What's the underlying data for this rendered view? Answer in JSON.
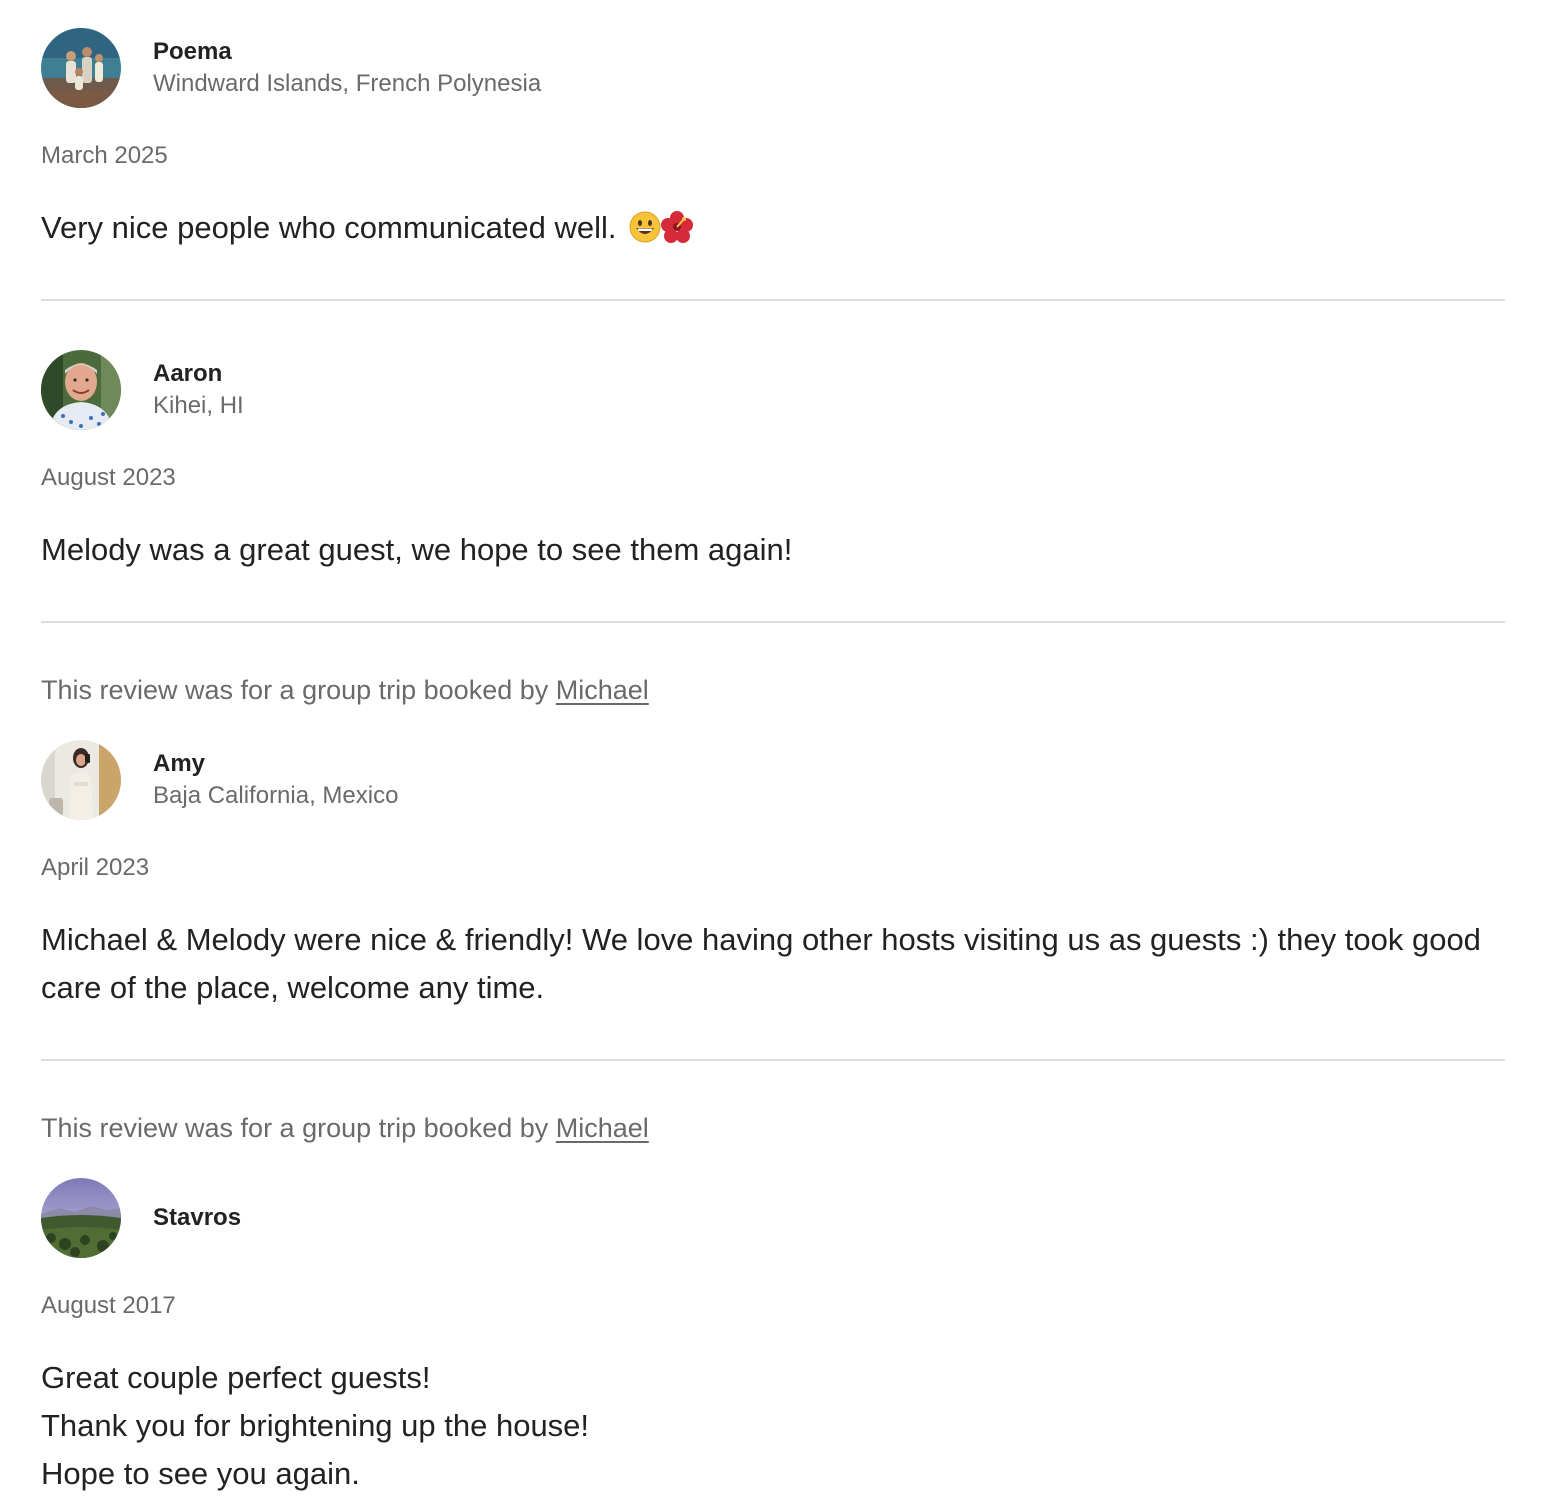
{
  "reviews": [
    {
      "name": "Poema",
      "location": "Windward Islands, French Polynesia",
      "date": "March 2025",
      "text": "Very nice people who communicated well.",
      "emojis": [
        "grinning-face-icon",
        "hibiscus-icon"
      ],
      "avatar": "family-beach-photo"
    },
    {
      "name": "Aaron",
      "location": "Kihei, HI",
      "date": "August 2023",
      "text": "Melody was a great guest, we hope to see them again!",
      "avatar": "man-portrait-photo"
    },
    {
      "group_note_prefix": "This review was for a group trip booked by",
      "group_note_link": "Michael",
      "name": "Amy",
      "location": "Baja California, Mexico",
      "date": "April 2023",
      "text": "Michael & Melody were nice & friendly! We love having other hosts visiting us as guests :) they took good care of the place, welcome any time.",
      "avatar": "woman-mirror-selfie-photo"
    },
    {
      "group_note_prefix": "This review was for a group trip booked by",
      "group_note_link": "Michael",
      "name": "Stavros",
      "date": "August 2017",
      "text_lines": [
        "Great couple perfect guests!",
        "Thank you for brightening up the house!",
        "Hope to see you again."
      ],
      "avatar": "landscape-photo"
    }
  ],
  "colors": {
    "primary_text": "#222222",
    "secondary_text": "#6a6a6a",
    "divider": "#dddddd"
  }
}
